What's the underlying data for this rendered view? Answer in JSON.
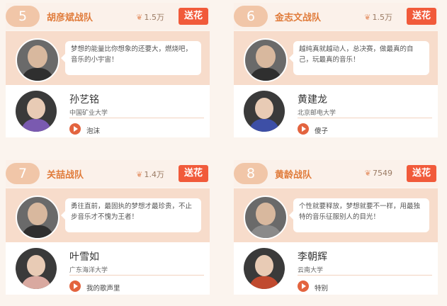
{
  "cards": [
    {
      "number": "5",
      "team": "胡彦斌战队",
      "votes": "1.5万",
      "gift_label": "送花",
      "coach_quote": "梦想的能量比你想象的还要大，燃烧吧，音乐的小宇宙！",
      "student_name": "孙艺铭",
      "student_school": "中国矿业大学",
      "song": "泡沫"
    },
    {
      "number": "6",
      "team": "金志文战队",
      "votes": "1.5万",
      "gift_label": "送花",
      "coach_quote": "越纯真就越动人，总决赛，做最真的自己，玩最真的音乐！",
      "student_name": "黄建龙",
      "student_school": "北京邮电大学",
      "song": "傻子"
    },
    {
      "number": "7",
      "team": "关喆战队",
      "votes": "1.4万",
      "gift_label": "送花",
      "coach_quote": "勇往直前，最固执的梦想才最珍贵，不止步音乐才不愧为王者！",
      "student_name": "叶雪如",
      "student_school": "广东海洋大学",
      "song": "我的歌声里"
    },
    {
      "number": "8",
      "team": "黄龄战队",
      "votes": "7549",
      "gift_label": "送花",
      "coach_quote": "个性就要释放，梦想就要不一样，用最独特的音乐征服别人的目光！",
      "student_name": "李朝辉",
      "student_school": "云南大学",
      "song": "特别"
    }
  ]
}
